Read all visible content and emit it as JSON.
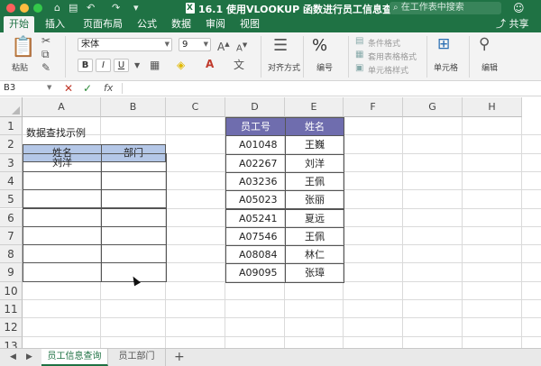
{
  "window": {
    "title": "16.1 使用VLOOKUP 函数进行员工信息查询.xls...",
    "search_placeholder": "在工作表中搜索"
  },
  "ribbon_tabs": [
    "开始",
    "插入",
    "页面布局",
    "公式",
    "数据",
    "审阅",
    "视图"
  ],
  "share_label": "共享",
  "ribbon": {
    "paste_label": "粘贴",
    "font_name": "宋体",
    "font_size": "9",
    "grow_font": "A",
    "shrink_font": "A",
    "bold": "B",
    "italic": "I",
    "underline": "U",
    "align_label": "对齐方式",
    "percent_symbol": "%",
    "number_label": "编号",
    "cond_format_label": "条件格式",
    "table_format_label": "套用表格格式",
    "cell_style_label": "单元格样式",
    "cells_label": "单元格",
    "edit_label": "编辑"
  },
  "formula_bar": {
    "name_box": "B3",
    "fx": "fx",
    "cancel": "✕",
    "confirm": "✓",
    "content": ""
  },
  "columns": [
    "A",
    "B",
    "C",
    "D",
    "E",
    "F",
    "G",
    "H"
  ],
  "rows": [
    "1",
    "2",
    "3",
    "4",
    "5",
    "6",
    "7",
    "8",
    "9",
    "10",
    "11",
    "12",
    "13"
  ],
  "cells": {
    "A1": "数据查找示例",
    "A2": "姓名",
    "B2": "部门",
    "A3": "刘洋"
  },
  "employee_table": {
    "headers": [
      "员工号",
      "姓名"
    ],
    "rows": [
      [
        "A01048",
        "王巍"
      ],
      [
        "A02267",
        "刘洋"
      ],
      [
        "A03236",
        "王佩"
      ],
      [
        "A05023",
        "张丽"
      ],
      [
        "A05241",
        "夏远"
      ],
      [
        "A07546",
        "王佩"
      ],
      [
        "A08084",
        "林仁"
      ],
      [
        "A09095",
        "张璋"
      ]
    ]
  },
  "sheet_tabs": [
    "员工信息查询",
    "员工部门"
  ],
  "add_sheet": "+",
  "colors": {
    "brand": "#1f7244",
    "lookup_header": "#b4c7e7",
    "table_header": "#6f6dae"
  }
}
